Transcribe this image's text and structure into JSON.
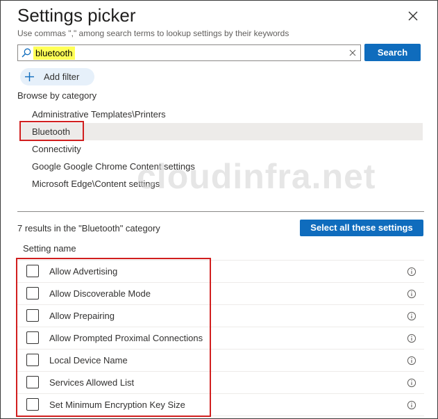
{
  "dialog": {
    "title": "Settings picker",
    "subtitle": "Use commas \",\" among search terms to lookup settings by their keywords"
  },
  "search": {
    "value": "bluetooth",
    "button_label": "Search"
  },
  "filter": {
    "add_label": "Add filter"
  },
  "browse": {
    "label": "Browse by category",
    "categories": [
      {
        "label": "Administrative Templates\\Printers"
      },
      {
        "label": "Bluetooth"
      },
      {
        "label": "Connectivity"
      },
      {
        "label": "Google Google Chrome Content settings"
      },
      {
        "label": "Microsoft Edge\\Content settings"
      }
    ],
    "selected": "Bluetooth"
  },
  "watermark": "cloudinfra.net",
  "results": {
    "summary": "7 results in the \"Bluetooth\" category",
    "select_all_label": "Select all these settings",
    "column_header": "Setting name",
    "settings": [
      {
        "name": "Allow Advertising",
        "checked": false
      },
      {
        "name": "Allow Discoverable Mode",
        "checked": false
      },
      {
        "name": "Allow Prepairing",
        "checked": false
      },
      {
        "name": "Allow Prompted Proximal Connections",
        "checked": false
      },
      {
        "name": "Local Device Name",
        "checked": false
      },
      {
        "name": "Services Allowed List",
        "checked": false
      },
      {
        "name": "Set Minimum Encryption Key Size",
        "checked": false
      }
    ]
  },
  "colors": {
    "primary_button": "#0f6cbd",
    "highlight_box": "#d11e1e",
    "search_highlight": "#ffff56",
    "selected_row": "#edebe9"
  },
  "icons": {
    "close": "close-icon",
    "search": "search-icon",
    "clear": "clear-icon",
    "add": "plus-icon",
    "info": "info-icon"
  }
}
